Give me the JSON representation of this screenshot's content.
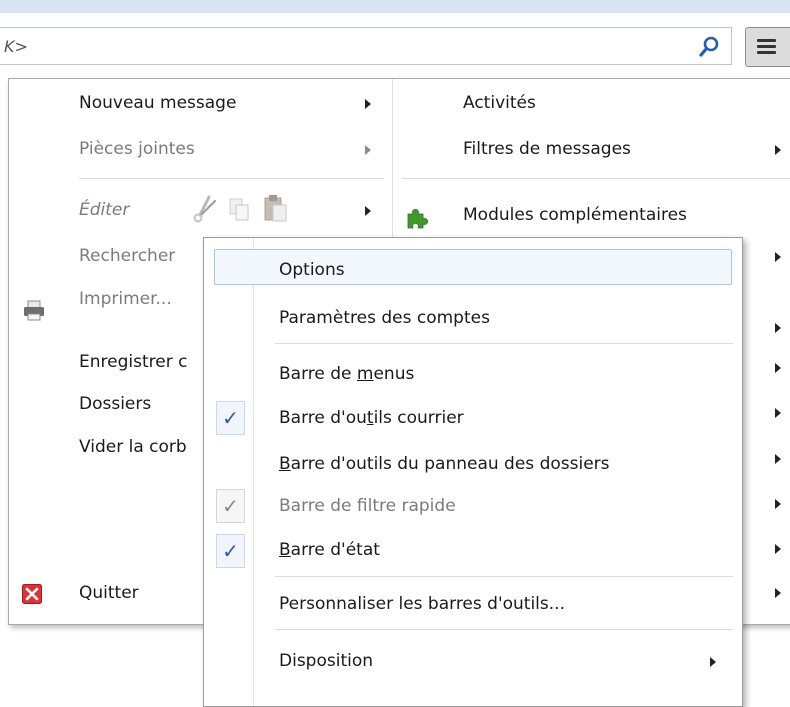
{
  "search": {
    "text": "K>"
  },
  "main_menu": {
    "left_column": [
      {
        "label": "Nouveau message"
      },
      {
        "label": "Pièces jointes"
      },
      {
        "label": "Éditer"
      },
      {
        "label": "Rechercher"
      },
      {
        "label": "Imprimer..."
      },
      {
        "label": "Enregistrer c"
      },
      {
        "label": "Dossiers"
      },
      {
        "label": "Vider la corb"
      },
      {
        "label": "Quitter"
      }
    ],
    "right_column": [
      {
        "label": "Activités"
      },
      {
        "label": "Filtres de messages"
      },
      {
        "label": "Modules complémentaires"
      }
    ]
  },
  "submenu": {
    "items": [
      {
        "label": "Options"
      },
      {
        "label": "Paramètres des comptes"
      },
      {
        "pre": "Barre de ",
        "acc": "m",
        "post": "enus"
      },
      {
        "pre": "Barre d'ou",
        "acc": "t",
        "post": "ils courrier"
      },
      {
        "pre": "",
        "acc": "B",
        "post": "arre d'outils du panneau des dossiers"
      },
      {
        "label": "Barre de filtre rapide"
      },
      {
        "pre": "",
        "acc": "B",
        "post": "arre d'état"
      },
      {
        "label": "Personnaliser les barres d'outils..."
      },
      {
        "label": "Disposition"
      }
    ]
  },
  "icons": {
    "search": "search-icon",
    "menu": "hamburger-menu-icon",
    "print": "printer-icon",
    "quit": "quit-icon",
    "addons": "puzzle-piece-icon",
    "edit_cut": "scissors-icon",
    "edit_copy": "copy-icon",
    "edit_paste": "paste-icon",
    "check": "checkmark-icon"
  },
  "colors": {
    "accent": "#2b57b4",
    "highlight_border": "#a6c7ea",
    "quit_red": "#d9343a",
    "addons_green": "#3f9a2d"
  }
}
